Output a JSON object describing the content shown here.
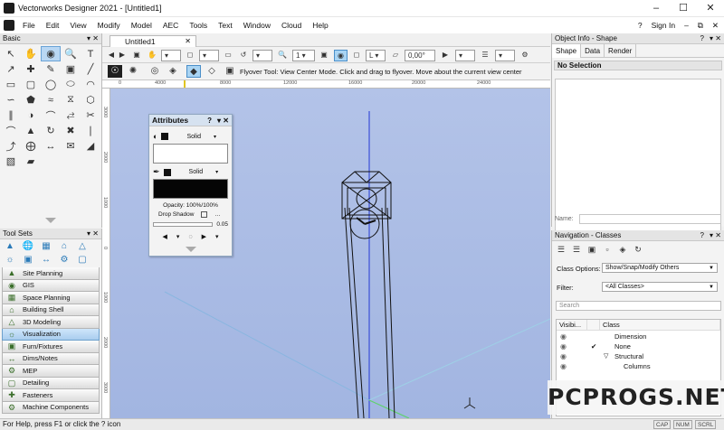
{
  "window": {
    "title": "Vectorworks Designer 2021 - [Untitled1]",
    "min_icon": "minimize-icon",
    "max_icon": "maximize-icon",
    "close_icon": "close-icon"
  },
  "menu": {
    "items": [
      "File",
      "Edit",
      "View",
      "Modify",
      "Model",
      "AEC",
      "Tools",
      "Text",
      "Window",
      "Cloud",
      "Help"
    ],
    "help_icon": "?",
    "sign_in": "Sign In"
  },
  "basic_palette": {
    "title": "Basic"
  },
  "toolsets": {
    "title": "Tool Sets",
    "items": [
      {
        "label": "Site Planning",
        "active": false
      },
      {
        "label": "GIS",
        "active": false
      },
      {
        "label": "Space Planning",
        "active": false
      },
      {
        "label": "Building Shell",
        "active": false
      },
      {
        "label": "3D Modeling",
        "active": false
      },
      {
        "label": "Visualization",
        "active": true
      },
      {
        "label": "Furn/Fixtures",
        "active": false
      },
      {
        "label": "Dims/Notes",
        "active": false
      },
      {
        "label": "MEP",
        "active": false
      },
      {
        "label": "Detailing",
        "active": false
      },
      {
        "label": "Fasteners",
        "active": false
      },
      {
        "label": "Machine Components",
        "active": false
      }
    ]
  },
  "document": {
    "tab_label": "Untitled1"
  },
  "viewbar": {
    "layer_value": "1",
    "angle_value": "0,00°",
    "scale_value": "L"
  },
  "modebar": {
    "hint": "Flyover Tool: View Center Mode. Click and drag to flyover. Move about the current view center"
  },
  "rulers": {
    "h_ticks": [
      "0",
      "4000",
      "8000",
      "12000",
      "16000",
      "20000",
      "24000"
    ],
    "v_ticks": [
      "3000",
      "2000",
      "1000",
      "0",
      "1000",
      "2000",
      "3000"
    ]
  },
  "attributes": {
    "title": "Attributes",
    "fill_label": "Solid",
    "pen_label": "Solid",
    "opacity": "Opacity: 100%/100%",
    "drop_shadow": "Drop Shadow",
    "line_weight": "0.05"
  },
  "object_info": {
    "title": "Object Info - Shape",
    "tabs": [
      "Shape",
      "Data",
      "Render"
    ],
    "selection": "No Selection",
    "name_label": "Name:"
  },
  "navigation": {
    "title": "Navigation - Classes",
    "class_options_label": "Class Options:",
    "class_options_value": "Show/Snap/Modify Others",
    "filter_label": "Filter:",
    "filter_value": "<All Classes>",
    "search_placeholder": "Search",
    "columns": [
      "Visibi...",
      "Class"
    ],
    "rows": [
      {
        "name": "Dimension",
        "check": ""
      },
      {
        "name": "None",
        "check": "✔"
      },
      {
        "name": "Structural",
        "check": ""
      },
      {
        "name": "Columns",
        "check": ""
      }
    ]
  },
  "status": {
    "message": "For Help, press F1 or click the ? icon",
    "indicators": [
      "CAP",
      "NUM",
      "SCRL"
    ]
  },
  "watermark": "PCPROGS.NET",
  "colors": {
    "canvas": "#a9bbe4",
    "selection": "#a9d4f3",
    "accent": "#4b8fc9"
  }
}
